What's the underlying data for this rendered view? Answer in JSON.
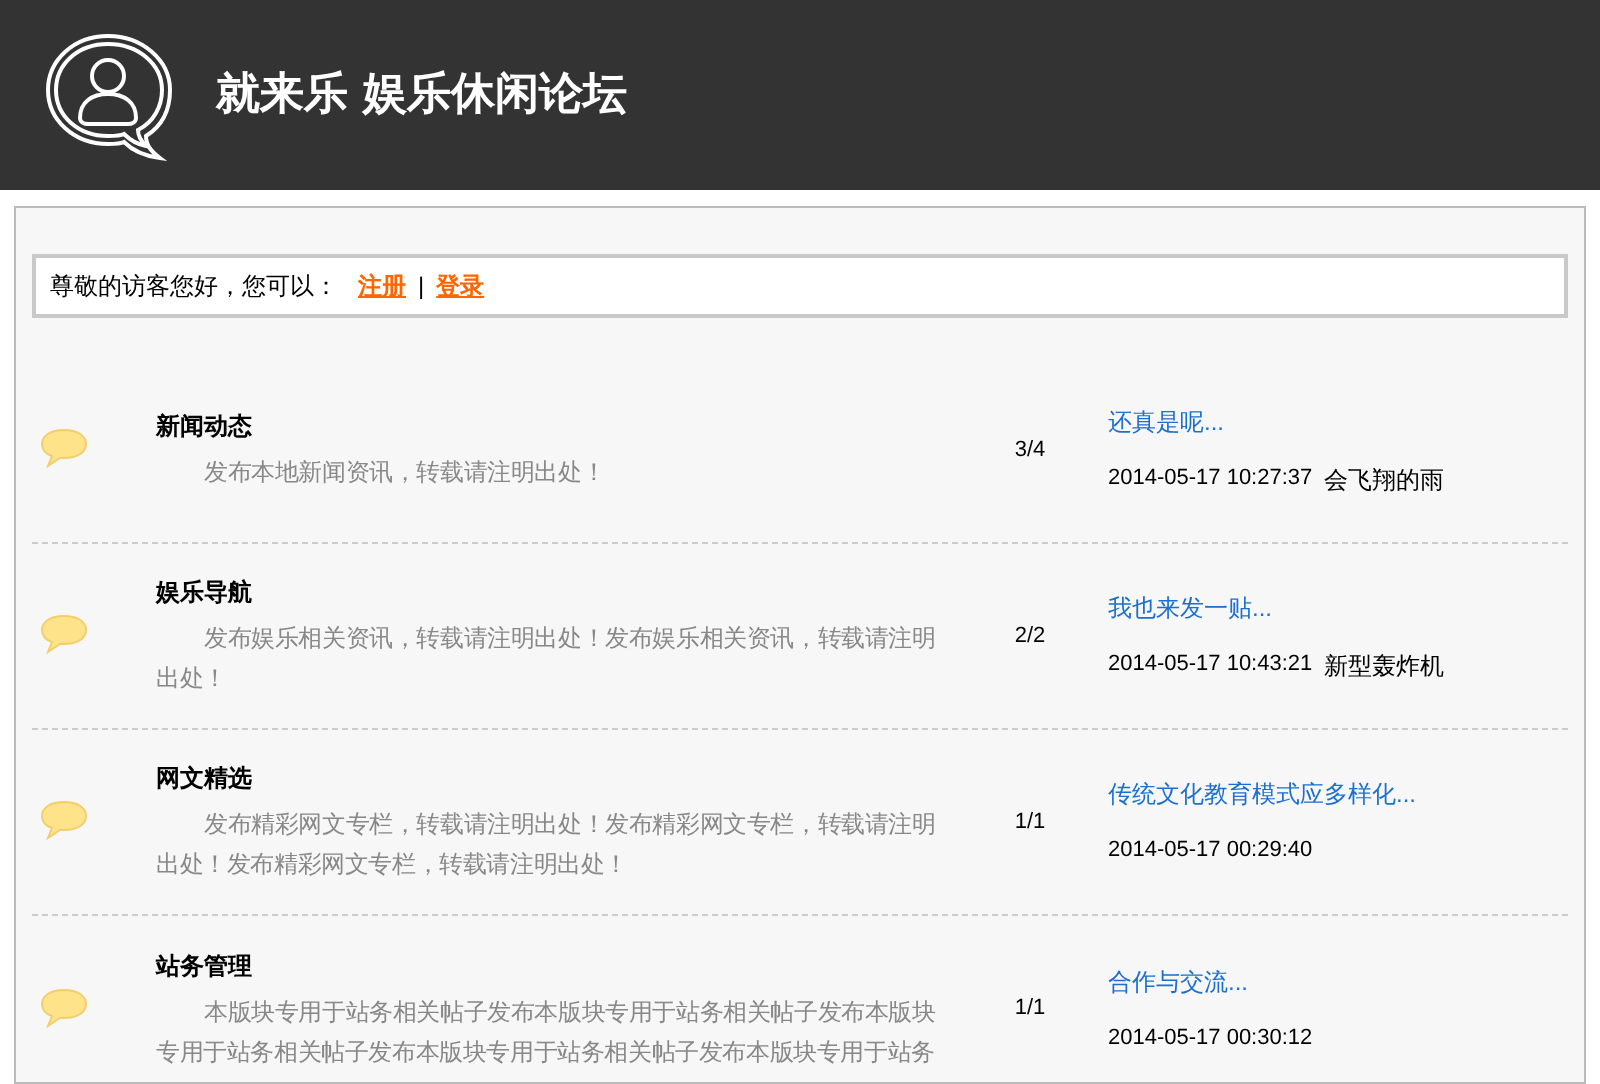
{
  "header": {
    "title": "就来乐 娱乐休闲论坛"
  },
  "greeting": {
    "text": "尊敬的访客您好，您可以：",
    "links": [
      "注册",
      "登录"
    ],
    "separator": "|"
  },
  "forums": [
    {
      "name": "新闻动态",
      "description": "发布本地新闻资讯，转载请注明出处！",
      "count": "3/4",
      "last_title": "还真是呢...",
      "last_time": "2014-05-17 10:27:37",
      "last_user": "会飞翔的雨"
    },
    {
      "name": "娱乐导航",
      "description": "发布娱乐相关资讯，转载请注明出处！发布娱乐相关资讯，转载请注明出处！",
      "count": "2/2",
      "last_title": "我也来发一贴...",
      "last_time": "2014-05-17 10:43:21",
      "last_user": "新型轰炸机"
    },
    {
      "name": "网文精选",
      "description": "发布精彩网文专栏，转载请注明出处！发布精彩网文专栏，转载请注明出处！发布精彩网文专栏，转载请注明出处！",
      "count": "1/1",
      "last_title": "传统文化教育模式应多样化...",
      "last_time": "2014-05-17 00:29:40"
    },
    {
      "name": "站务管理",
      "description": "本版块专用于站务相关帖子发布本版块专用于站务相关帖子发布本版块专用于站务相关帖子发布本版块专用于站务相关帖子发布本版块专用于站务",
      "count": "1/1",
      "last_title": "合作与交流...",
      "last_time": "2014-05-17 00:30:12"
    }
  ]
}
